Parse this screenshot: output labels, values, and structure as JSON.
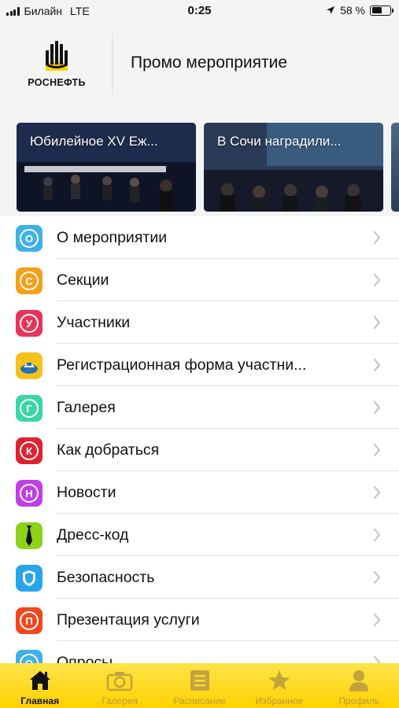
{
  "status_bar": {
    "carrier": "Билайн",
    "network": "LTE",
    "time": "0:25",
    "battery": "58 %",
    "battery_level": 0.58
  },
  "header": {
    "logo_text": "РОСНЕФТЬ",
    "title": "Промо мероприятие"
  },
  "carousel": [
    {
      "title": "Юбилейное XV Еж..."
    },
    {
      "title": "В Сочи наградили..."
    }
  ],
  "menu": [
    {
      "label": "О мероприятии",
      "letter": "О",
      "color": "#3fb1e6",
      "icon": "info-icon"
    },
    {
      "label": "Секции",
      "letter": "С",
      "color": "#f5a01a",
      "icon": "sections-icon"
    },
    {
      "label": "Участники",
      "letter": "У",
      "color": "#e8345a",
      "icon": "participants-icon"
    },
    {
      "label": "Регистрационная форма участни...",
      "letter": "",
      "color": "#f4c21d",
      "icon": "registration-icon"
    },
    {
      "label": "Галерея",
      "letter": "Г",
      "color": "#3bd6a8",
      "icon": "gallery-icon"
    },
    {
      "label": "Как добраться",
      "letter": "К",
      "color": "#e0212f",
      "icon": "directions-icon"
    },
    {
      "label": "Новости",
      "letter": "Н",
      "color": "#c13ee6",
      "icon": "news-icon"
    },
    {
      "label": "Дресс-код",
      "letter": "",
      "color": "#8ed21a",
      "icon": "tie-icon"
    },
    {
      "label": "Безопасность",
      "letter": "",
      "color": "#27a6ec",
      "icon": "shield-icon"
    },
    {
      "label": "Презентация услуги",
      "letter": "П",
      "color": "#f2471e",
      "icon": "presentation-icon"
    },
    {
      "label": "Опросы",
      "letter": "О",
      "color": "#3fb1e6",
      "icon": "polls-icon"
    }
  ],
  "tabbar": [
    {
      "label": "Главная",
      "icon": "home-icon",
      "active": true
    },
    {
      "label": "Галерея",
      "icon": "camera-icon",
      "active": false
    },
    {
      "label": "Расписание",
      "icon": "schedule-icon",
      "active": false
    },
    {
      "label": "Избранное",
      "icon": "star-icon",
      "active": false
    },
    {
      "label": "Профиль",
      "icon": "profile-icon",
      "active": false
    }
  ]
}
